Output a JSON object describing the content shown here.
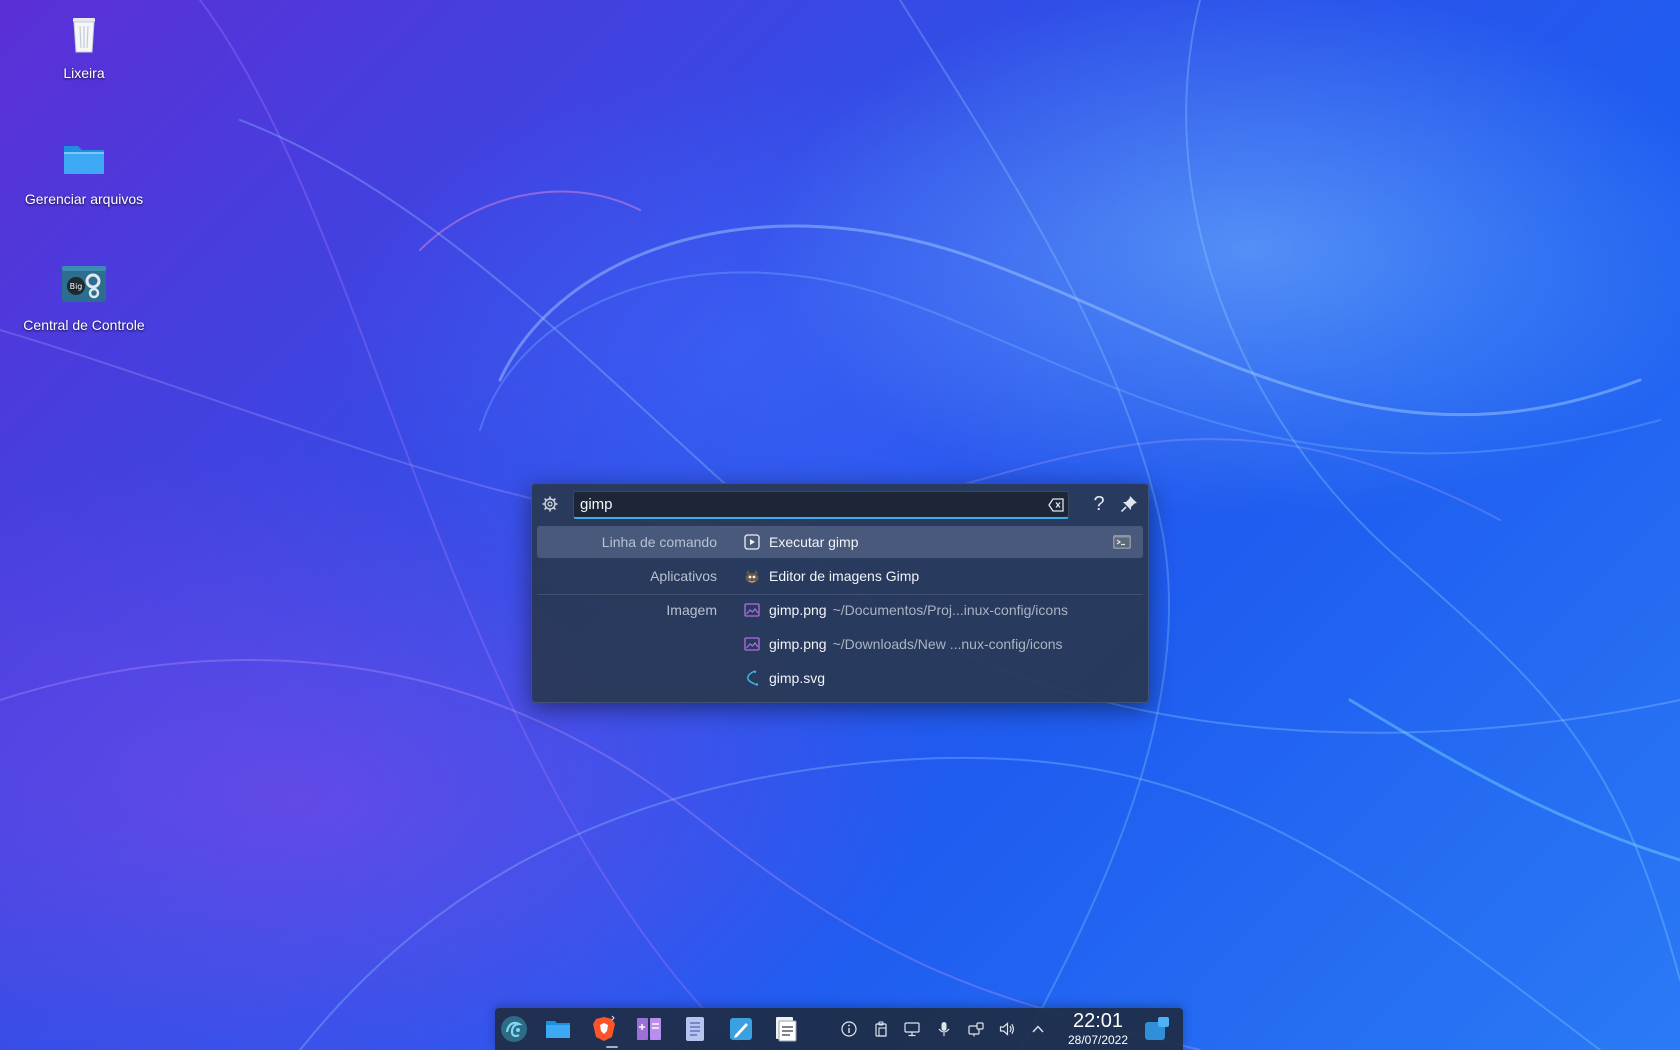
{
  "desktop": {
    "icons": [
      {
        "label": "Lixeira",
        "icon": "trash-icon"
      },
      {
        "label": "Gerenciar arquivos",
        "icon": "folder-icon"
      },
      {
        "label": "Central de Controle",
        "icon": "control-center-icon"
      }
    ]
  },
  "krunner": {
    "query": "gimp",
    "results": [
      {
        "category": "Linha de comando",
        "title": "Executar gimp",
        "subtitle": "",
        "icon": "run-command-icon",
        "selected": true
      },
      {
        "category": "Aplicativos",
        "title": "Editor de imagens Gimp",
        "subtitle": "",
        "icon": "gimp-icon",
        "selected": false
      },
      {
        "category": "Imagem",
        "title": "gimp.png",
        "subtitle": "~/Documentos/Proj...inux-config/icons",
        "icon": "image-file-icon",
        "selected": false
      },
      {
        "category": "",
        "title": "gimp.png",
        "subtitle": "~/Downloads/New ...nux-config/icons",
        "icon": "image-file-icon",
        "selected": false
      },
      {
        "category": "",
        "title": "gimp.svg",
        "subtitle": "",
        "icon": "svg-file-icon",
        "selected": false
      }
    ]
  },
  "taskbar": {
    "apps": [
      {
        "name": "app-launcher-icon"
      },
      {
        "name": "file-manager-icon"
      },
      {
        "name": "brave-browser-icon"
      },
      {
        "name": "kate-editor-icon"
      },
      {
        "name": "document-viewer-icon"
      },
      {
        "name": "notes-icon"
      },
      {
        "name": "scanner-icon"
      }
    ],
    "tray": [
      "info-icon",
      "clipboard-icon",
      "display-icon",
      "microphone-icon",
      "network-icon",
      "volume-icon",
      "chevron-up-icon"
    ],
    "clock": {
      "time": "22:01",
      "date": "28/07/2022"
    }
  },
  "colors": {
    "accent": "#3daee9",
    "panel": "#1e2c44"
  }
}
